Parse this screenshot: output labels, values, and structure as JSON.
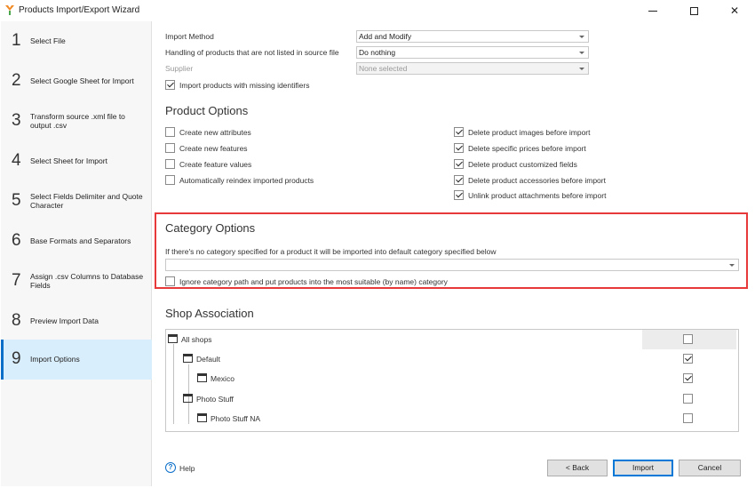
{
  "window": {
    "title": "Products Import/Export Wizard"
  },
  "steps": [
    {
      "num": "1",
      "label": "Select File"
    },
    {
      "num": "2",
      "label": "Select Google Sheet for Import"
    },
    {
      "num": "3",
      "label": "Transform source .xml file to output .csv"
    },
    {
      "num": "4",
      "label": "Select Sheet for Import"
    },
    {
      "num": "5",
      "label": "Select Fields Delimiter and Quote Character"
    },
    {
      "num": "6",
      "label": "Base Formats and Separators"
    },
    {
      "num": "7",
      "label": "Assign .csv Columns to Database Fields"
    },
    {
      "num": "8",
      "label": "Preview Import Data"
    },
    {
      "num": "9",
      "label": "Import Options"
    }
  ],
  "import": {
    "method_label": "Import Method",
    "method_value": "Add and Modify",
    "handling_label": "Handling of products that are not listed in source file",
    "handling_value": "Do nothing",
    "supplier_label": "Supplier",
    "supplier_value": "None selected",
    "missing_ids_label": "Import products with missing identifiers"
  },
  "product_options": {
    "title": "Product Options",
    "left": [
      {
        "label": "Create new attributes",
        "checked": false
      },
      {
        "label": "Create new features",
        "checked": false
      },
      {
        "label": "Create feature values",
        "checked": false
      },
      {
        "label": "Automatically reindex imported products",
        "checked": false
      }
    ],
    "right": [
      {
        "label": "Delete product images before import",
        "checked": true
      },
      {
        "label": "Delete specific prices before import",
        "checked": true
      },
      {
        "label": "Delete product customized fields",
        "checked": true
      },
      {
        "label": "Delete product accessories before import",
        "checked": true
      },
      {
        "label": "Unlink product attachments before import",
        "checked": true
      }
    ]
  },
  "category_options": {
    "title": "Category Options",
    "note": "If there's no category specified for a product it will be imported into default category specified below",
    "default_category_value": "",
    "ignore_path_label": "Ignore category path and put products into the most suitable (by name) category"
  },
  "shop_association": {
    "title": "Shop Association",
    "rows": [
      {
        "label": "All shops",
        "checked": false
      },
      {
        "label": "Default",
        "checked": true
      },
      {
        "label": "Mexico",
        "checked": true
      },
      {
        "label": "Photo Stuff",
        "checked": false
      },
      {
        "label": "Photo Stuff NA",
        "checked": false
      }
    ]
  },
  "footer": {
    "help_label": "Help",
    "back_label": "< Back",
    "import_label": "Import",
    "cancel_label": "Cancel"
  }
}
